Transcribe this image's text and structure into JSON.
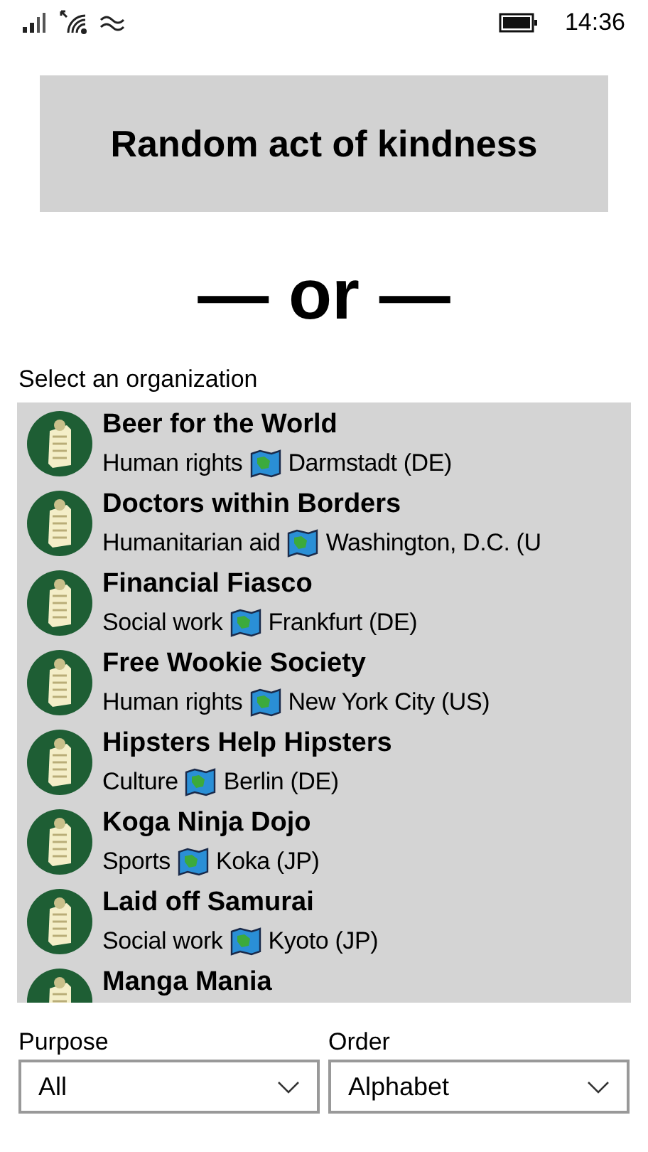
{
  "status_bar": {
    "time": "14:36"
  },
  "action_button": {
    "label": "Random act of kindness"
  },
  "separator": "— or —",
  "list_label": "Select an organization",
  "organizations": [
    {
      "name": "Beer for the World",
      "purpose": "Human rights",
      "location": "Darmstadt (DE)"
    },
    {
      "name": "Doctors within Borders",
      "purpose": "Humanitarian aid",
      "location": "Washington, D.C. (U"
    },
    {
      "name": "Financial Fiasco",
      "purpose": "Social work",
      "location": "Frankfurt (DE)"
    },
    {
      "name": "Free Wookie Society",
      "purpose": "Human rights",
      "location": "New York City (US)"
    },
    {
      "name": "Hipsters Help Hipsters",
      "purpose": "Culture",
      "location": "Berlin (DE)"
    },
    {
      "name": "Koga Ninja Dojo",
      "purpose": "Sports",
      "location": "Koka (JP)"
    },
    {
      "name": "Laid off Samurai",
      "purpose": "Social work",
      "location": "Kyoto (JP)"
    },
    {
      "name": "Manga Mania"
    }
  ],
  "filters": [
    {
      "label": "Purpose",
      "value": "All"
    },
    {
      "label": "Order",
      "value": "Alphabet"
    }
  ]
}
